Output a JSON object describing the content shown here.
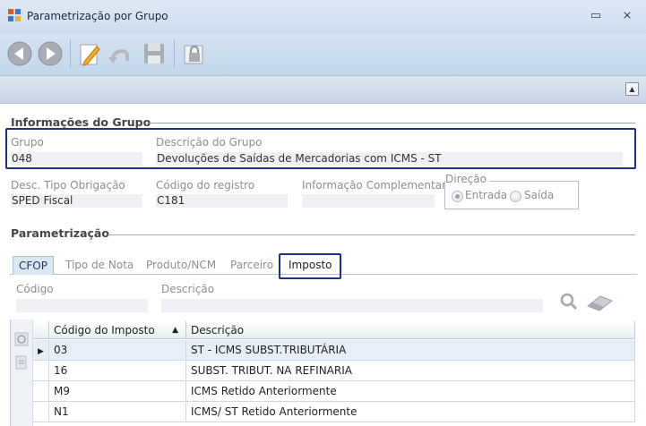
{
  "window": {
    "title": "Parametrização por Grupo",
    "minimize_glyph": "▭",
    "close_glyph": "⨯"
  },
  "toolbar": {
    "buttons": [
      {
        "name": "back-icon"
      },
      {
        "name": "forward-icon"
      },
      {
        "name": "edit-icon"
      },
      {
        "name": "undo-icon"
      },
      {
        "name": "save-icon"
      },
      {
        "name": "lock-icon"
      }
    ]
  },
  "info": {
    "section_title": "Informações do Grupo",
    "grupo_label": "Grupo",
    "grupo_value": "048",
    "descricao_label": "Descrição do Grupo",
    "descricao_value": "Devoluções de Saídas de Mercadorias com ICMS - ST",
    "tipo_label": "Desc. Tipo Obrigação",
    "tipo_value": "SPED Fiscal",
    "registro_label": "Código do registro",
    "registro_value": "C181",
    "complementar_label": "Informação Complementar",
    "complementar_value": "",
    "direcao_label": "Direção",
    "entrada_label": "Entrada",
    "saida_label": "Saída"
  },
  "param": {
    "section_title": "Parametrização",
    "tabs": [
      "CFOP",
      "Tipo de Nota",
      "Produto/NCM",
      "Parceiro",
      "Imposto"
    ],
    "codigo_label": "Código",
    "descricao_label": "Descrição"
  },
  "grid": {
    "columns": [
      "Código do Imposto",
      "Descrição"
    ],
    "rows": [
      {
        "code": "03",
        "desc": "ST - ICMS SUBST.TRIBUTÁRIA"
      },
      {
        "code": "16",
        "desc": "SUBST. TRIBUT. NA REFINARIA"
      },
      {
        "code": "M9",
        "desc": "ICMS Retido Anteriormente"
      },
      {
        "code": "N1",
        "desc": "ICMS/ ST Retido Anteriormente"
      }
    ]
  },
  "colors": {
    "highlight": "#1f2f8f",
    "titlebar": "#cdddee",
    "selected_row": "#e6eef7"
  }
}
